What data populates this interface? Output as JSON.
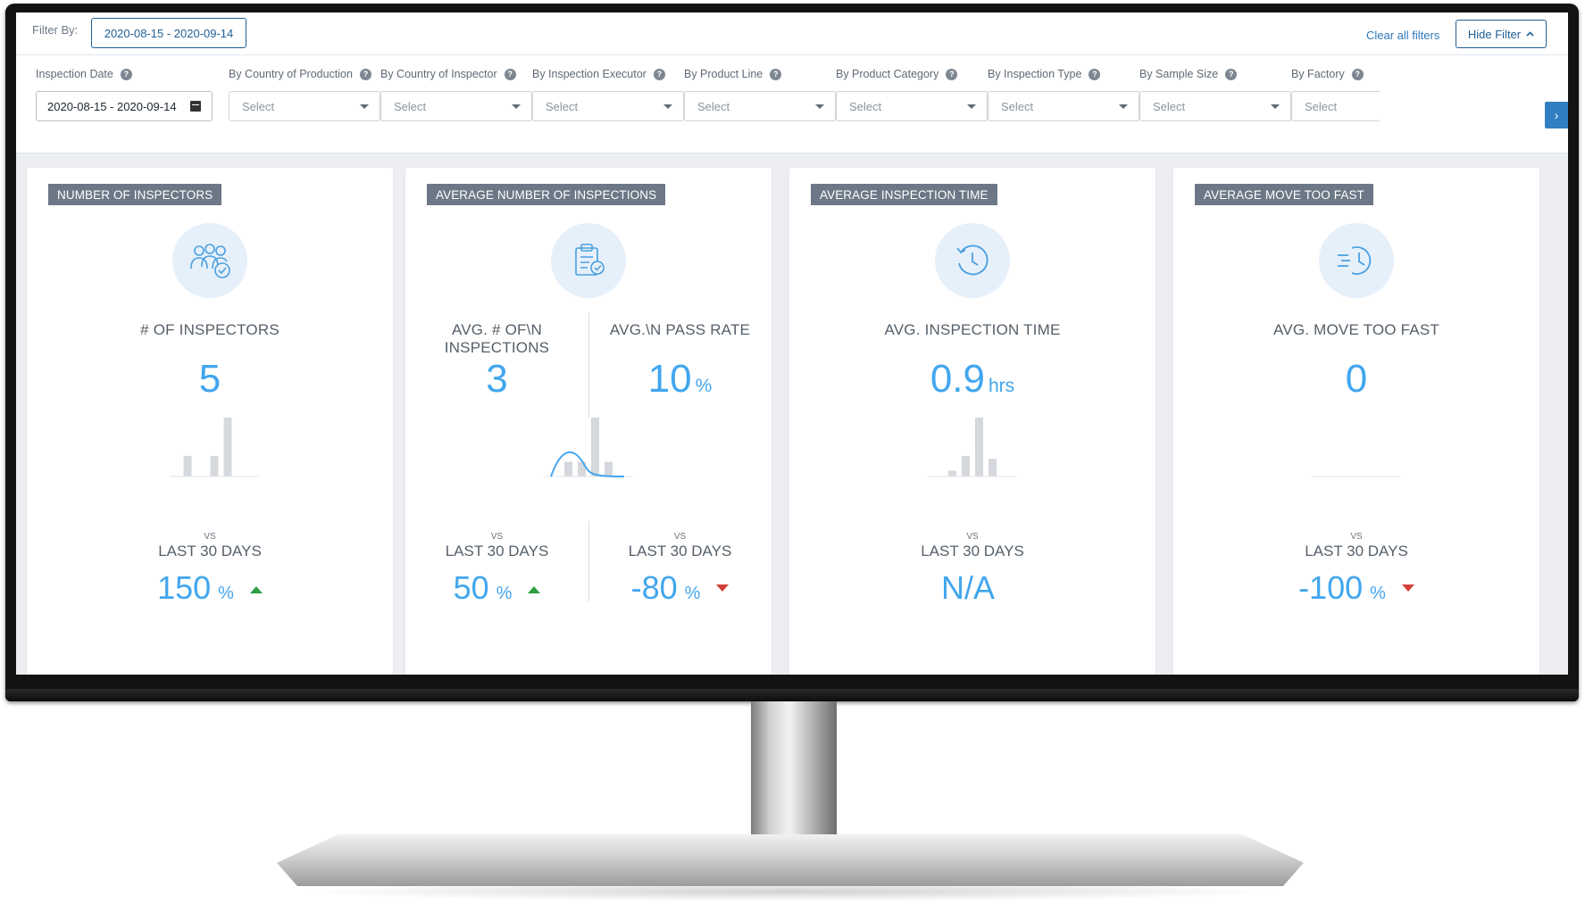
{
  "filterbar": {
    "filter_by_label": "Filter By:",
    "active_chip": "2020-08-15 - 2020-09-14",
    "clear_all": "Clear all filters",
    "hide_filter": "Hide Filter"
  },
  "filters": [
    {
      "label": "Inspection Date",
      "value": "2020-08-15 - 2020-09-14",
      "type": "date"
    },
    {
      "label": "By Country of Production",
      "value": "Select",
      "type": "select"
    },
    {
      "label": "By Country of Inspector",
      "value": "Select",
      "type": "select"
    },
    {
      "label": "By Inspection Executor",
      "value": "Select",
      "type": "select"
    },
    {
      "label": "By Product Line",
      "value": "Select",
      "type": "select"
    },
    {
      "label": "By Product Category",
      "value": "Select",
      "type": "select"
    },
    {
      "label": "By Inspection Type",
      "value": "Select",
      "type": "select"
    },
    {
      "label": "By Sample Size",
      "value": "Select",
      "type": "select"
    },
    {
      "label": "By Factory",
      "value": "Select",
      "type": "select"
    }
  ],
  "cards": [
    {
      "tag": "NUMBER OF INSPECTORS",
      "icon": "people-check-icon",
      "metric_label": "# OF INSPECTORS",
      "metric_value": "5",
      "vs": "VS",
      "last_days": "LAST 30 DAYS",
      "change_value": "150",
      "change_unit": "%",
      "trend": "up",
      "histogram": [
        0.35,
        0.0,
        0.35,
        1.0,
        0.0
      ]
    },
    {
      "tag": "AVERAGE NUMBER OF INSPECTIONS",
      "icon": "clipboard-check-icon",
      "left": {
        "metric_label_line1": "AVG. # OF\\N",
        "metric_label_line2": "INSPECTIONS",
        "metric_value": "3",
        "vs": "VS",
        "last_days": "LAST 30 DAYS",
        "change_value": "50",
        "change_unit": "%",
        "trend": "up"
      },
      "right": {
        "metric_label": "AVG.\\N PASS RATE",
        "metric_value": "10",
        "metric_unit": "%",
        "vs": "VS",
        "last_days": "LAST 30 DAYS",
        "change_value": "-80",
        "change_unit": "%",
        "trend": "down"
      },
      "histogram": [
        0.25,
        0.25,
        1.0,
        0.25
      ]
    },
    {
      "tag": "AVERAGE INSPECTION TIME",
      "icon": "clock-refresh-icon",
      "metric_label": "AVG. INSPECTION TIME",
      "metric_value": "0.9",
      "metric_unit": "hrs",
      "vs": "VS",
      "last_days": "LAST 30 DAYS",
      "change_value": "N/A",
      "trend": "none",
      "histogram": [
        0.1,
        0.35,
        1.0,
        0.3
      ]
    },
    {
      "tag": "AVERAGE MOVE TOO FAST",
      "icon": "fast-clock-icon",
      "metric_label": "AVG. MOVE TOO FAST",
      "metric_value": "0",
      "vs": "VS",
      "last_days": "LAST 30 DAYS",
      "change_value": "-100",
      "change_unit": "%",
      "trend": "down",
      "histogram": []
    }
  ],
  "colors": {
    "accent": "#42a6ee",
    "tag_bg": "#6c7886",
    "up": "#2e9e45",
    "down": "#d6403a",
    "chip_border": "#1f5f94"
  }
}
